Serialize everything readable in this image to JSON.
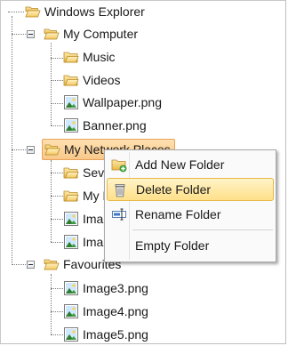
{
  "tree": {
    "root": {
      "label": "Windows Explorer",
      "icon": "folder-open-icon"
    },
    "my_computer": {
      "label": "My Computer",
      "icon": "folder-open-icon",
      "children": [
        {
          "label": "Music",
          "icon": "folder-icon"
        },
        {
          "label": "Videos",
          "icon": "folder-icon"
        },
        {
          "label": "Wallpaper.png",
          "icon": "image-file-icon"
        },
        {
          "label": "Banner.png",
          "icon": "image-file-icon"
        }
      ]
    },
    "my_network_places": {
      "label": "My Network Places",
      "icon": "folder-open-icon",
      "children": [
        {
          "label": "Seve",
          "icon": "folder-icon"
        },
        {
          "label": "My F",
          "icon": "folder-icon"
        },
        {
          "label": "Imag",
          "icon": "image-file-icon"
        },
        {
          "label": "Imag",
          "icon": "image-file-icon"
        }
      ]
    },
    "favourites": {
      "label": "Favourites",
      "icon": "folder-open-icon",
      "children": [
        {
          "label": "Image3.png",
          "icon": "image-file-icon"
        },
        {
          "label": "Image4.png",
          "icon": "image-file-icon"
        },
        {
          "label": "Image5.png",
          "icon": "image-file-icon"
        }
      ]
    }
  },
  "context_menu": {
    "items": [
      {
        "label": "Add New Folder",
        "icon": "add-folder-icon"
      },
      {
        "label": "Delete Folder",
        "icon": "trash-icon",
        "highlighted": true
      },
      {
        "label": "Rename Folder",
        "icon": "rename-icon"
      },
      {
        "label": "Empty Folder"
      }
    ]
  },
  "colors": {
    "selection_fill": "#f8c88a",
    "menu_hover_fill": "#ffe08a",
    "folder_yellow": "#f7d36b"
  }
}
